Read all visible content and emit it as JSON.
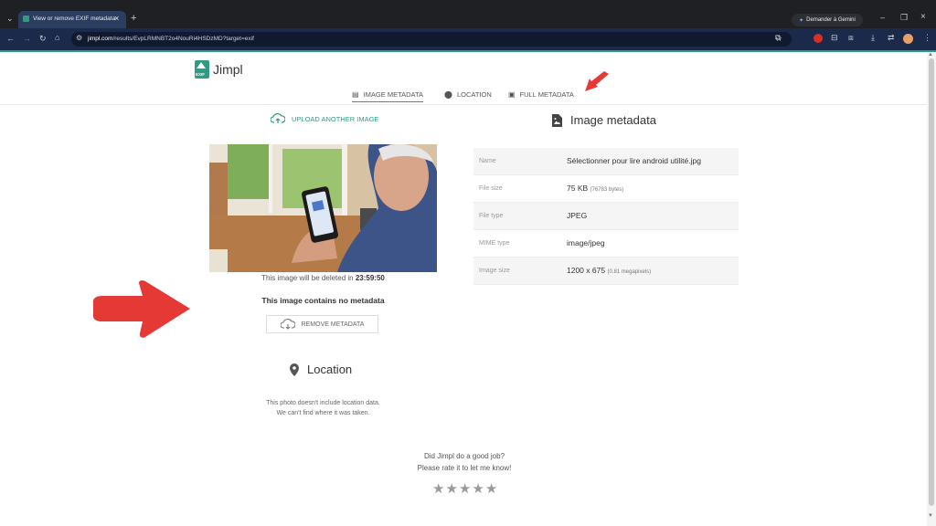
{
  "browser": {
    "tab_title": "View or remove EXIF metadata",
    "url_domain": "jimpl.com",
    "url_path": "/results/EvpLRMNBT2o4NouRi4HSDzMD?target=exif",
    "gemini_label": "Demander à Gemini"
  },
  "site": {
    "logo_text": "Jimpl",
    "logo_badge": "EXIF"
  },
  "nav": {
    "tabs": [
      {
        "label": "IMAGE METADATA",
        "icon": "file-image-icon"
      },
      {
        "label": "LOCATION",
        "icon": "map-pin-icon"
      },
      {
        "label": "FULL METADATA",
        "icon": "list-box-icon"
      }
    ],
    "active": 0
  },
  "left": {
    "upload_label": "UPLOAD ANOTHER IMAGE",
    "delete_prefix": "This image will be deleted in ",
    "delete_time": "23:59:50",
    "no_metadata": "This image contains no metadata",
    "remove_label": "REMOVE METADATA"
  },
  "metadata": {
    "title": "Image metadata",
    "rows": [
      {
        "label": "Name",
        "value": "Sélectionner pour lire android utilité.jpg",
        "note": ""
      },
      {
        "label": "File size",
        "value": "75 KB",
        "note": "(76783 bytes)"
      },
      {
        "label": "File type",
        "value": "JPEG",
        "note": ""
      },
      {
        "label": "MIME type",
        "value": "image/jpeg",
        "note": ""
      },
      {
        "label": "Image size",
        "value": "1200 x 675",
        "note": "(0.81 megapixels)"
      }
    ]
  },
  "location": {
    "title": "Location",
    "line1": "This photo doesn't include location data.",
    "line2": "We can't find where it was taken."
  },
  "rating": {
    "line1": "Did Jimpl do a good job?",
    "line2": "Please rate it to let me know!",
    "stars_filled": 0,
    "stars_total": 5
  },
  "colors": {
    "accent": "#2e9c82",
    "annotation_arrow": "#e53935",
    "chrome_bg": "#1f2024"
  }
}
